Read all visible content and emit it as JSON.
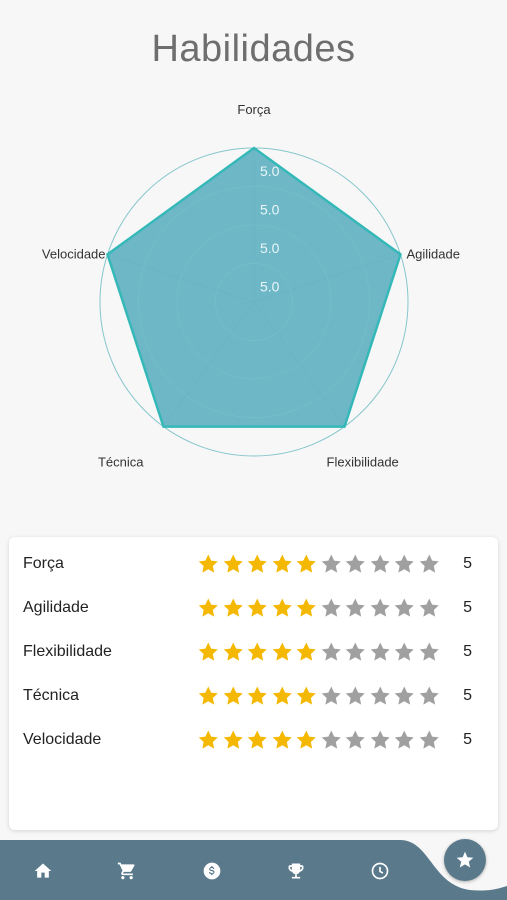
{
  "title": "Habilidades",
  "chart_data": {
    "type": "radar",
    "axes": [
      "Força",
      "Agilidade",
      "Flexibilidade",
      "Técnica",
      "Velocidade"
    ],
    "values": [
      5,
      5,
      5,
      5,
      5
    ],
    "max": 5,
    "tick_labels": [
      "5.0",
      "5.0",
      "5.0",
      "5.0"
    ],
    "fill_color": "#5aaec0",
    "stroke_color": "#35b8b8",
    "grid_color": "#86c6cc"
  },
  "skills": [
    {
      "label": "Força",
      "rating": 5,
      "max": 10,
      "value": "5"
    },
    {
      "label": "Agilidade",
      "rating": 5,
      "max": 10,
      "value": "5"
    },
    {
      "label": "Flexibilidade",
      "rating": 5,
      "max": 10,
      "value": "5"
    },
    {
      "label": "Técnica",
      "rating": 5,
      "max": 10,
      "value": "5"
    },
    {
      "label": "Velocidade",
      "rating": 5,
      "max": 10,
      "value": "5"
    }
  ],
  "colors": {
    "star_filled": "#f5b800",
    "star_empty": "#a0a0a0",
    "nav_bg": "#5a7a8c"
  },
  "nav": {
    "items": [
      "home-icon",
      "cart-icon",
      "dollar-icon",
      "trophy-icon",
      "clock-icon"
    ],
    "active": "star-icon"
  }
}
